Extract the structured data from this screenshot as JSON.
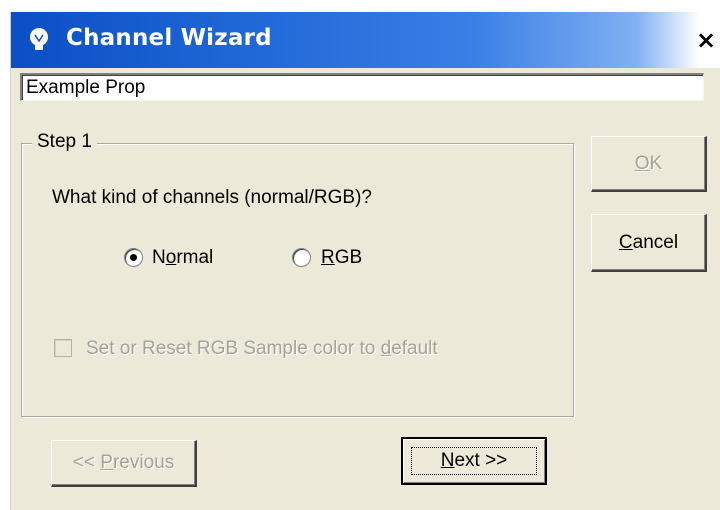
{
  "window": {
    "title": "Channel Wizard",
    "close_glyph": "×"
  },
  "prop": {
    "name_value": "Example Prop"
  },
  "step": {
    "label": "Step 1",
    "question": "What kind of channels (normal/RGB)?",
    "options": [
      {
        "prefix": "N",
        "underlined": "o",
        "suffix": "rmal",
        "selected": true
      },
      {
        "prefix": "",
        "underlined": "R",
        "suffix": "GB",
        "selected": false
      }
    ],
    "checkbox": {
      "prefix": "Set or Reset RGB Sample color to ",
      "underlined": "d",
      "suffix": "efault",
      "checked": false,
      "disabled": true
    }
  },
  "buttons": {
    "ok": {
      "underlined": "O",
      "suffix": "K",
      "disabled": true
    },
    "cancel": {
      "underlined": "C",
      "suffix": "ancel",
      "disabled": false
    },
    "previous": {
      "prefix": "<< ",
      "underlined": "P",
      "suffix": "revious",
      "disabled": true
    },
    "next": {
      "underlined": "N",
      "suffix": "ext >>",
      "disabled": false
    }
  },
  "colors": {
    "titlebar_start": "#0a4fc4",
    "dialog_bg": "#ece9d8",
    "disabled_text": "#a5a297"
  },
  "icons": {
    "title": "lightbulb-icon",
    "close": "close-icon"
  }
}
